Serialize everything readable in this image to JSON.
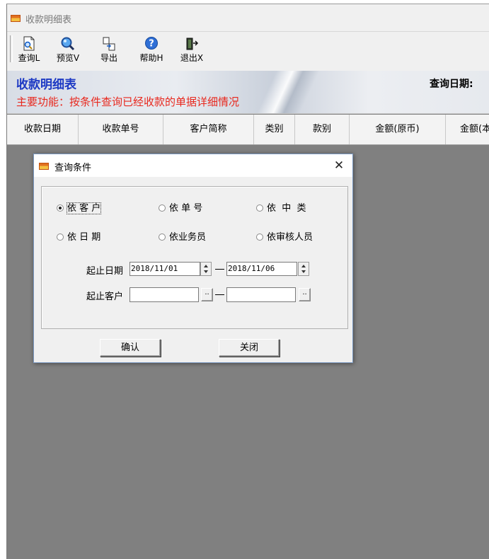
{
  "window": {
    "title": "收款明细表"
  },
  "toolbar": {
    "buttons": [
      {
        "label": "查询L",
        "icon": "document-search-icon"
      },
      {
        "label": "预览V",
        "icon": "magnifier-icon"
      },
      {
        "label": "导出",
        "icon": "export-icon"
      },
      {
        "label": "帮助H",
        "icon": "help-icon"
      },
      {
        "label": "退出X",
        "icon": "exit-door-icon"
      }
    ]
  },
  "banner": {
    "title": "收款明细表",
    "subtitle": "主要功能：按条件查询已经收款的单据详细情况",
    "query_date_label": "查询日期:"
  },
  "grid": {
    "columns": [
      "收款日期",
      "收款单号",
      "客户简称",
      "类别",
      "款别",
      "金额(原币)",
      "金额(本"
    ]
  },
  "dialog": {
    "title": "查询条件",
    "close_glyph": "✕",
    "options": [
      {
        "label": "依 客 户",
        "checked": true
      },
      {
        "label": "依 单 号",
        "checked": false
      },
      {
        "label": "依  中  类",
        "checked": false
      },
      {
        "label": "依 日 期",
        "checked": false
      },
      {
        "label": "依业务员",
        "checked": false
      },
      {
        "label": "依审核人员",
        "checked": false
      }
    ],
    "date_range": {
      "label": "起止日期",
      "from": "2018/11/01",
      "to": "2018/11/06"
    },
    "customer_range": {
      "label": "起止客户",
      "from": "",
      "to": "",
      "browse": ".."
    },
    "confirm_label": "确认",
    "close_label": "关闭"
  },
  "colors": {
    "banner_title": "#1d39c4",
    "banner_subtitle": "#e8281e",
    "workspace": "#808080"
  }
}
